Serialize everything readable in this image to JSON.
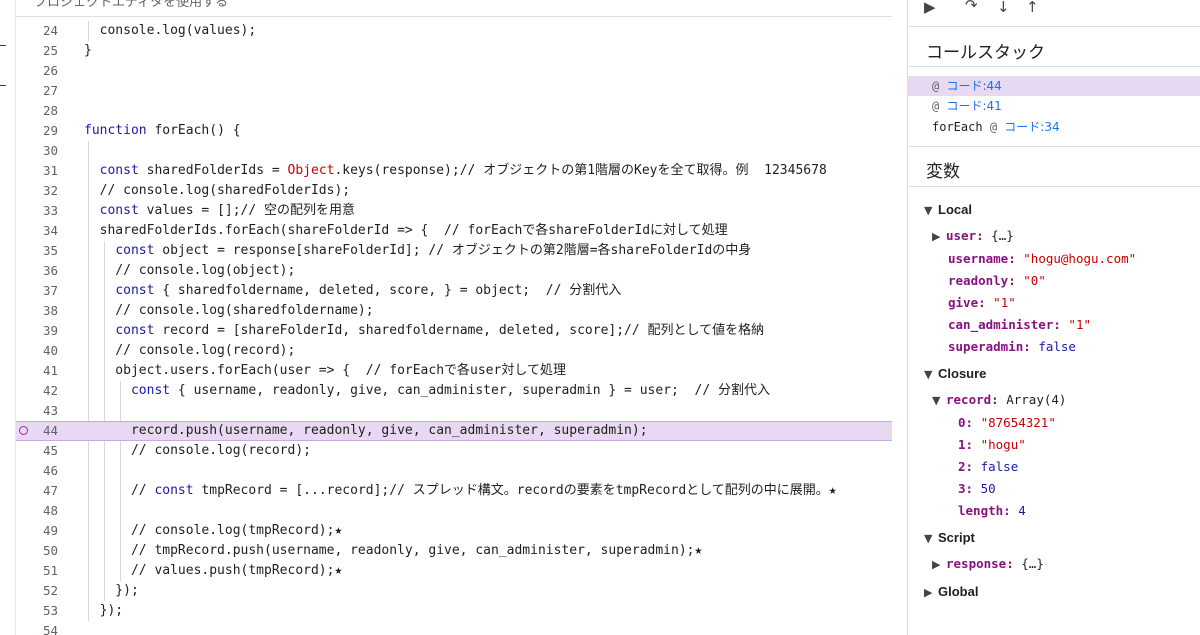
{
  "editor": {
    "top_label": "プロジェクトエディタを使用する",
    "lines": [
      {
        "n": "24",
        "text": "  console.log(values);"
      },
      {
        "n": "25",
        "text": "}"
      },
      {
        "n": "26",
        "text": ""
      },
      {
        "n": "27",
        "text": ""
      },
      {
        "n": "28",
        "text": ""
      },
      {
        "n": "29",
        "text": "function forEach() {"
      },
      {
        "n": "30",
        "text": ""
      },
      {
        "n": "31",
        "text": "  const sharedFolderIds = Object.keys(response);// オブジェクトの第1階層のKeyを全て取得。例  12345678"
      },
      {
        "n": "32",
        "text": "  // console.log(sharedFolderIds);"
      },
      {
        "n": "33",
        "text": "  const values = [];// 空の配列を用意"
      },
      {
        "n": "34",
        "text": "  sharedFolderIds.forEach(shareFolderId => {  // forEachで各shareFolderIdに対して処理"
      },
      {
        "n": "35",
        "text": "    const object = response[shareFolderId]; // オブジェクトの第2階層=各shareFolderIdの中身"
      },
      {
        "n": "36",
        "text": "    // console.log(object);"
      },
      {
        "n": "37",
        "text": "    const { sharedfoldername, deleted, score, } = object;  // 分割代入"
      },
      {
        "n": "38",
        "text": "    // console.log(sharedfoldername);"
      },
      {
        "n": "39",
        "text": "    const record = [shareFolderId, sharedfoldername, deleted, score];// 配列として値を格納"
      },
      {
        "n": "40",
        "text": "    // console.log(record);"
      },
      {
        "n": "41",
        "text": "    object.users.forEach(user => {  // forEachで各user対して処理"
      },
      {
        "n": "42",
        "text": "      const { username, readonly, give, can_administer, superadmin } = user;  // 分割代入"
      },
      {
        "n": "43",
        "text": ""
      },
      {
        "n": "44",
        "text": "      record.push(username, readonly, give, can_administer, superadmin);"
      },
      {
        "n": "45",
        "text": "      // console.log(record);"
      },
      {
        "n": "46",
        "text": ""
      },
      {
        "n": "47",
        "text": "      // const tmpRecord = [...record];// スプレッド構文。recordの要素をtmpRecordとして配列の中に展開。★"
      },
      {
        "n": "48",
        "text": ""
      },
      {
        "n": "49",
        "text": "      // console.log(tmpRecord);★"
      },
      {
        "n": "50",
        "text": "      // tmpRecord.push(username, readonly, give, can_administer, superadmin);★"
      },
      {
        "n": "51",
        "text": "      // values.push(tmpRecord);★"
      },
      {
        "n": "52",
        "text": "    });"
      },
      {
        "n": "53",
        "text": "  });"
      },
      {
        "n": "54",
        "text": ""
      }
    ],
    "highlight_line": "44"
  },
  "debugger": {
    "toolbar": {
      "resume": "▶",
      "step_over": "↷",
      "step_into": "↓",
      "step_out": "↑"
    },
    "callstack_title": "コールスタック",
    "frames": [
      {
        "fn": "",
        "at": "@",
        "link": "コード:44"
      },
      {
        "fn": "",
        "at": "@",
        "link": "コード:41"
      },
      {
        "fn": "forEach",
        "at": "@",
        "link": "コード:34"
      }
    ],
    "variables_title": "変数",
    "local_label": "Local",
    "user_key": "user:",
    "user_val": "{…}",
    "username_key": "username:",
    "username_val": "\"hogu@hogu.com\"",
    "readonly_key": "readonly:",
    "readonly_val": "\"0\"",
    "give_key": "give:",
    "give_val": "\"1\"",
    "can_key": "can_administer:",
    "can_val": "\"1\"",
    "super_key": "superadmin:",
    "super_val": "false",
    "closure_label": "Closure",
    "record_key": "record:",
    "record_val": "Array(4)",
    "r0_key": "0:",
    "r0_val": "\"87654321\"",
    "r1_key": "1:",
    "r1_val": "\"hogu\"",
    "r2_key": "2:",
    "r2_val": "false",
    "r3_key": "3:",
    "r3_val": "50",
    "len_key": "length:",
    "len_val": "4",
    "script_label": "Script",
    "response_key": "response:",
    "response_val": "{…}",
    "global_label": "Global"
  },
  "colors": {
    "highlight": "#e8d9f2",
    "breakpoint": "#9c27b0",
    "link": "#1a73e8"
  }
}
